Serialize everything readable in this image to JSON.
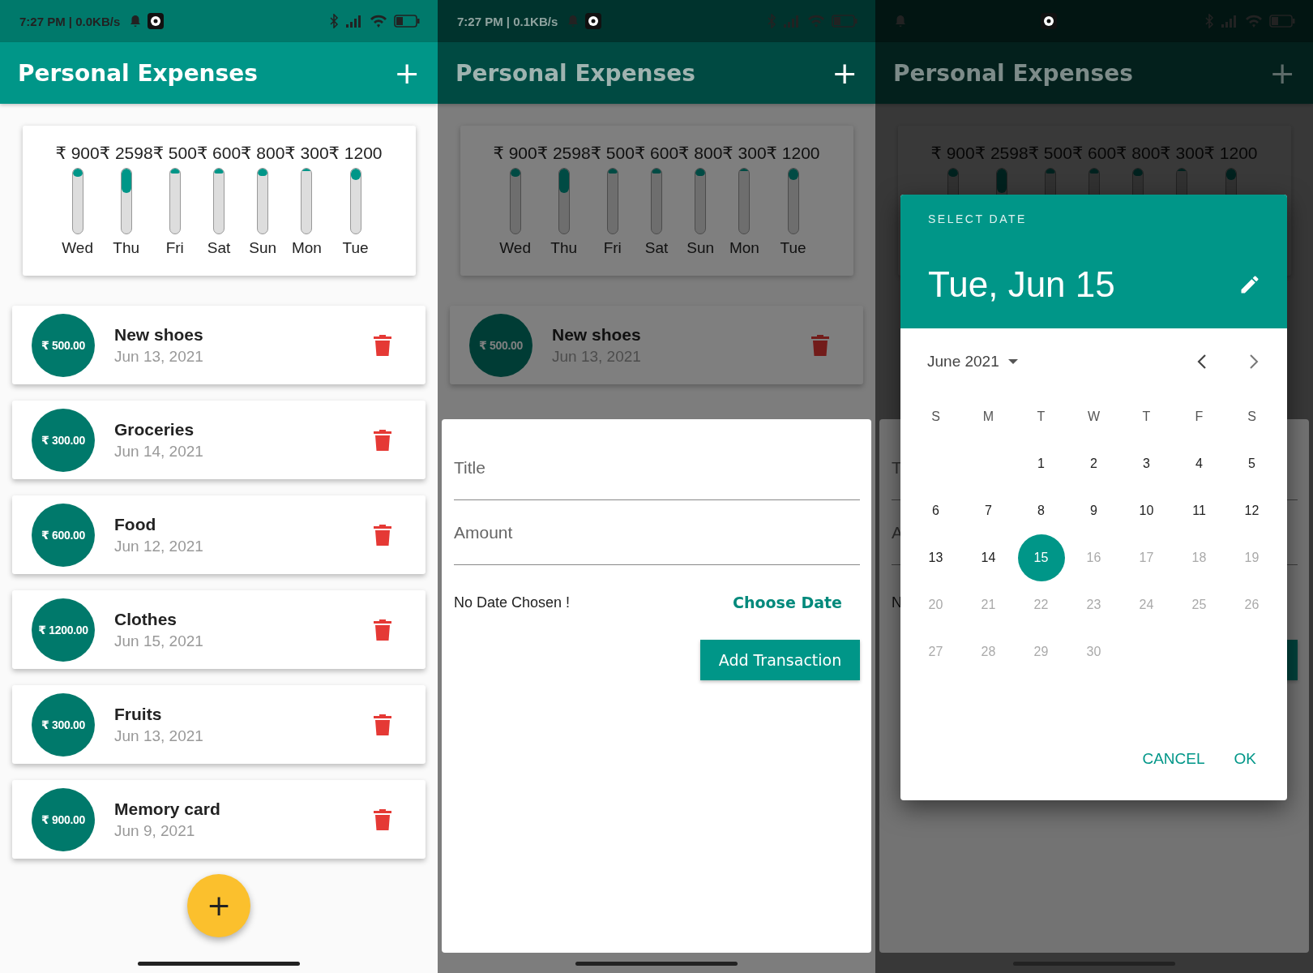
{
  "screens": [
    {
      "kind": "list",
      "status_bar": {
        "time": "7:27 PM | 0.0KB/s"
      },
      "app_bar": {
        "title": "Personal Expenses",
        "action": "+"
      },
      "chart": {
        "bars": [
          {
            "amount": "₹ 900",
            "day": "Wed",
            "level": 0.13
          },
          {
            "amount": "₹ 2598",
            "day": "Thu",
            "level": 0.37
          },
          {
            "amount": "₹ 500",
            "day": "Fri",
            "level": 0.07
          },
          {
            "amount": "₹ 600",
            "day": "Sat",
            "level": 0.08
          },
          {
            "amount": "₹ 800",
            "day": "Sun",
            "level": 0.11
          },
          {
            "amount": "₹ 300",
            "day": "Mon",
            "level": 0.04
          },
          {
            "amount": "₹ 1200",
            "day": "Tue",
            "level": 0.17
          }
        ]
      },
      "transactions": [
        {
          "amount": "₹ 500.00",
          "title": "New shoes",
          "date": "Jun 13, 2021"
        },
        {
          "amount": "₹ 300.00",
          "title": "Groceries",
          "date": "Jun 14, 2021"
        },
        {
          "amount": "₹ 600.00",
          "title": "Food",
          "date": "Jun 12, 2021"
        },
        {
          "amount": "₹ 1200.00",
          "title": "Clothes",
          "date": "Jun 15, 2021"
        },
        {
          "amount": "₹ 300.00",
          "title": "Fruits",
          "date": "Jun 13, 2021"
        },
        {
          "amount": "₹ 900.00",
          "title": "Memory card",
          "date": "Jun 9, 2021"
        }
      ],
      "fab": "+"
    },
    {
      "kind": "form",
      "status_bar": {
        "time": "7:27 PM | 0.1KB/s"
      },
      "app_bar": {
        "title": "Personal Expenses",
        "action": "+"
      },
      "chart": {
        "bars": [
          {
            "amount": "₹ 900",
            "day": "Wed",
            "level": 0.13
          },
          {
            "amount": "₹ 2598",
            "day": "Thu",
            "level": 0.37
          },
          {
            "amount": "₹ 500",
            "day": "Fri",
            "level": 0.07
          },
          {
            "amount": "₹ 600",
            "day": "Sat",
            "level": 0.08
          },
          {
            "amount": "₹ 800",
            "day": "Sun",
            "level": 0.11
          },
          {
            "amount": "₹ 300",
            "day": "Mon",
            "level": 0.04
          },
          {
            "amount": "₹ 1200",
            "day": "Tue",
            "level": 0.17
          }
        ]
      },
      "transactions": [
        {
          "amount": "₹ 500.00",
          "title": "New shoes",
          "date": "Jun 13, 2021"
        }
      ],
      "sheet": {
        "title_field": {
          "placeholder": "Title"
        },
        "amount_field": {
          "placeholder": "Amount"
        },
        "date_status": "No Date Chosen !",
        "choose_date": "Choose Date",
        "submit": "Add Transaction"
      }
    },
    {
      "kind": "picker",
      "app_bar": {
        "title": "Personal Expenses",
        "action": "+"
      },
      "chart": {
        "bars": [
          {
            "amount": "₹ 900",
            "level": 0.13
          },
          {
            "amount": "₹ 2598",
            "level": 0.37
          },
          {
            "amount": "₹ 500",
            "level": 0.07
          },
          {
            "amount": "₹ 600",
            "level": 0.08
          },
          {
            "amount": "₹ 800",
            "level": 0.11
          },
          {
            "amount": "₹ 300",
            "level": 0.04
          },
          {
            "amount": "₹ 1200",
            "level": 0.17
          }
        ]
      },
      "sheet": {
        "title_field": {
          "placeholder": "T"
        },
        "amount_field": {
          "placeholder": "A"
        },
        "date_status": "N"
      },
      "dialog": {
        "overline": "SELECT DATE",
        "date": "Tue, Jun 15",
        "month": "June 2021",
        "weekdays": [
          "S",
          "M",
          "T",
          "W",
          "T",
          "F",
          "S"
        ],
        "weeks": [
          [
            {
              "kind": "blank"
            },
            {
              "kind": "blank"
            },
            {
              "label": "1",
              "selected": false,
              "disabled": false
            },
            {
              "label": "2",
              "selected": false,
              "disabled": false
            },
            {
              "label": "3",
              "selected": false,
              "disabled": false
            },
            {
              "label": "4",
              "selected": false,
              "disabled": false
            },
            {
              "label": "5",
              "selected": false,
              "disabled": false
            }
          ],
          [
            {
              "label": "6",
              "selected": false,
              "disabled": false
            },
            {
              "label": "7",
              "selected": false,
              "disabled": false
            },
            {
              "label": "8",
              "selected": false,
              "disabled": false
            },
            {
              "label": "9",
              "selected": false,
              "disabled": false
            },
            {
              "label": "10",
              "selected": false,
              "disabled": false
            },
            {
              "label": "11",
              "selected": false,
              "disabled": false
            },
            {
              "label": "12",
              "selected": false,
              "disabled": false
            }
          ],
          [
            {
              "label": "13",
              "selected": false,
              "disabled": false
            },
            {
              "label": "14",
              "selected": false,
              "disabled": false
            },
            {
              "label": "15",
              "selected": true,
              "disabled": false
            },
            {
              "label": "16",
              "selected": false,
              "disabled": true
            },
            {
              "label": "17",
              "selected": false,
              "disabled": true
            },
            {
              "label": "18",
              "selected": false,
              "disabled": true
            },
            {
              "label": "19",
              "selected": false,
              "disabled": true
            }
          ],
          [
            {
              "label": "20",
              "selected": false,
              "disabled": true
            },
            {
              "label": "21",
              "selected": false,
              "disabled": true
            },
            {
              "label": "22",
              "selected": false,
              "disabled": true
            },
            {
              "label": "23",
              "selected": false,
              "disabled": true
            },
            {
              "label": "24",
              "selected": false,
              "disabled": true
            },
            {
              "label": "25",
              "selected": false,
              "disabled": true
            },
            {
              "label": "26",
              "selected": false,
              "disabled": true
            }
          ],
          [
            {
              "label": "27",
              "selected": false,
              "disabled": true
            },
            {
              "label": "28",
              "selected": false,
              "disabled": true
            },
            {
              "label": "29",
              "selected": false,
              "disabled": true
            },
            {
              "label": "30",
              "selected": false,
              "disabled": true
            }
          ]
        ],
        "actions": [
          "CANCEL",
          "OK"
        ]
      }
    }
  ]
}
